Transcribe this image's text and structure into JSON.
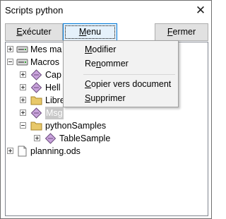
{
  "window": {
    "title": "Scripts python",
    "close_glyph": "✕"
  },
  "buttons": {
    "execute": {
      "pre": "",
      "key": "E",
      "post": "xécuter"
    },
    "menu": {
      "pre": "",
      "key": "M",
      "post": "enu"
    },
    "close": {
      "pre": "",
      "key": "F",
      "post": "ermer"
    }
  },
  "tree": {
    "items": [
      {
        "label": "Mes macros",
        "visible": "Mes ma",
        "icon": "drive-icon",
        "expander": "plus"
      },
      {
        "label": "Macros",
        "visible": "Macros",
        "icon": "drive-icon",
        "expander": "minus"
      },
      {
        "label": "Capitalise",
        "visible": "Cap",
        "icon": "script-icon",
        "expander": "plus"
      },
      {
        "label": "HelloWorld",
        "visible": "Hell",
        "icon": "script-icon",
        "expander": "plus"
      },
      {
        "label": "LibreLogo",
        "visible": "Libre",
        "icon": "folder-icon",
        "expander": "plus"
      },
      {
        "label": "Msg",
        "visible": "Msg",
        "icon": "script-icon",
        "expander": "plus",
        "selected": true
      },
      {
        "label": "pythonSamples",
        "visible": "pythonSamples",
        "icon": "folder-icon",
        "expander": "minus"
      },
      {
        "label": "TableSample",
        "visible": "TableSample",
        "icon": "script-icon",
        "expander": "plus"
      },
      {
        "label": "planning.ods",
        "visible": "planning.ods",
        "icon": "document-icon",
        "expander": "plus"
      }
    ]
  },
  "context_menu": {
    "items": [
      {
        "pre": "",
        "key": "M",
        "post": "odifier"
      },
      {
        "pre": "Re",
        "key": "n",
        "post": "ommer"
      },
      {
        "pre": "",
        "key": "C",
        "post": "opier vers document"
      },
      {
        "pre": "",
        "key": "S",
        "post": "upprimer"
      }
    ]
  }
}
